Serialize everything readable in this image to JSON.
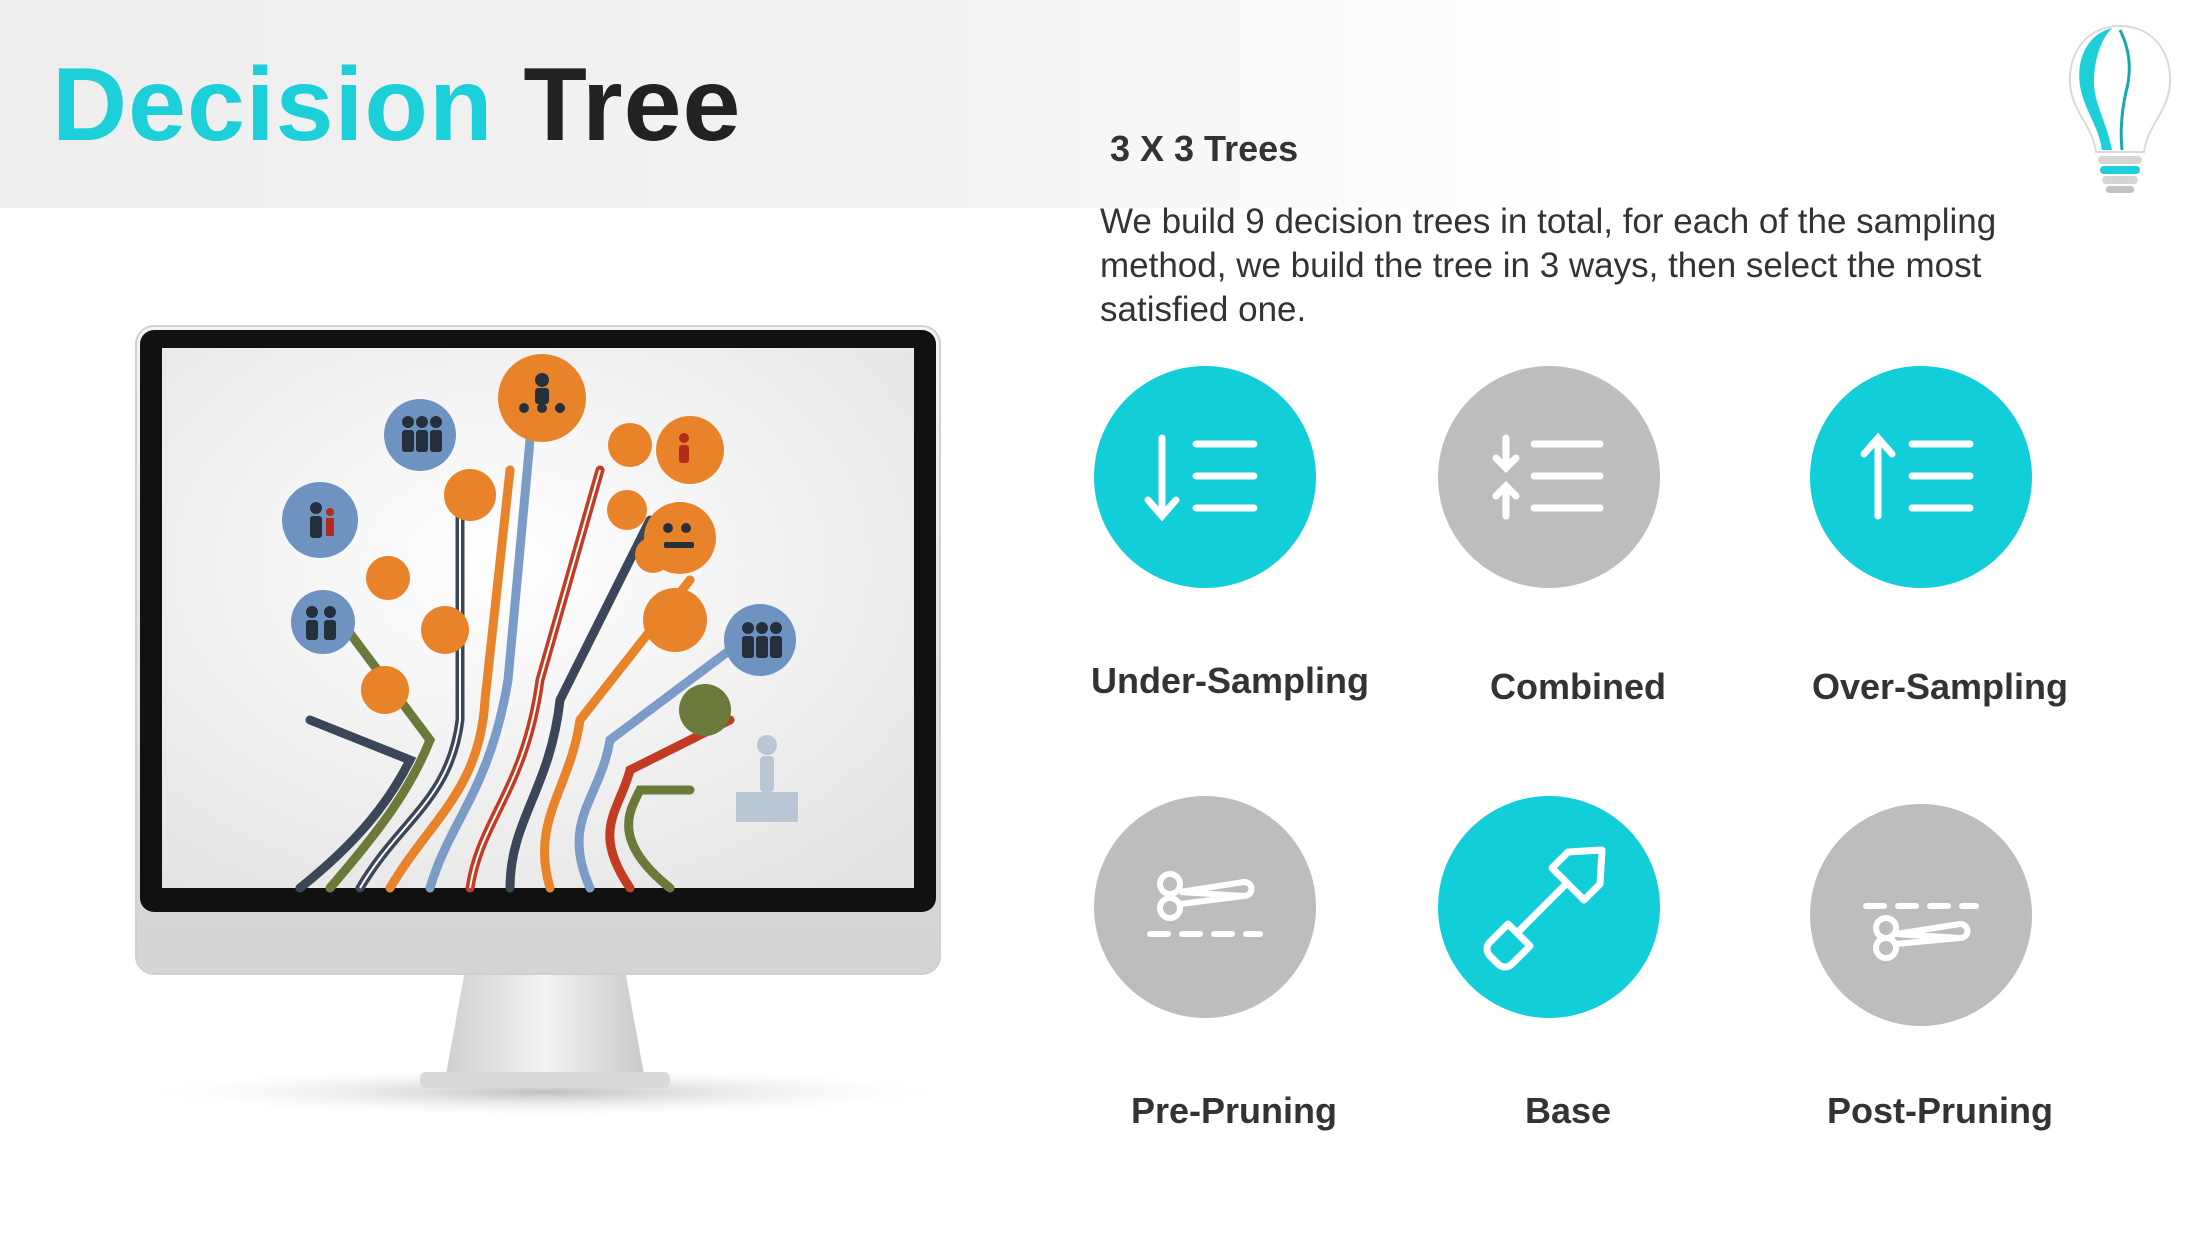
{
  "title": {
    "accent": "Decision",
    "rest": "Tree"
  },
  "subtitle": "3 X 3 Trees",
  "description": "We build 9 decision trees in total, for each of the sampling method, we build the tree in 3 ways, then select the most satisfied one.",
  "options": [
    {
      "label": "Under-Sampling",
      "icon": "sort-descending-list-icon",
      "color": "#11ced8"
    },
    {
      "label": "Combined",
      "icon": "sort-up-down-list-icon",
      "color": "#bdbdbd"
    },
    {
      "label": "Over-Sampling",
      "icon": "sort-ascending-list-icon",
      "color": "#11ced8"
    },
    {
      "label": "Pre-Pruning",
      "icon": "scissors-cut-line-icon",
      "color": "#bdbdbd"
    },
    {
      "label": "Base",
      "icon": "shovel-icon",
      "color": "#11ced8"
    },
    {
      "label": "Post-Pruning",
      "icon": "scissors-cut-line-icon",
      "color": "#bdbdbd"
    }
  ],
  "colors": {
    "accent": "#1ccfd9",
    "gray": "#bdbdbd",
    "text": "#333333"
  }
}
